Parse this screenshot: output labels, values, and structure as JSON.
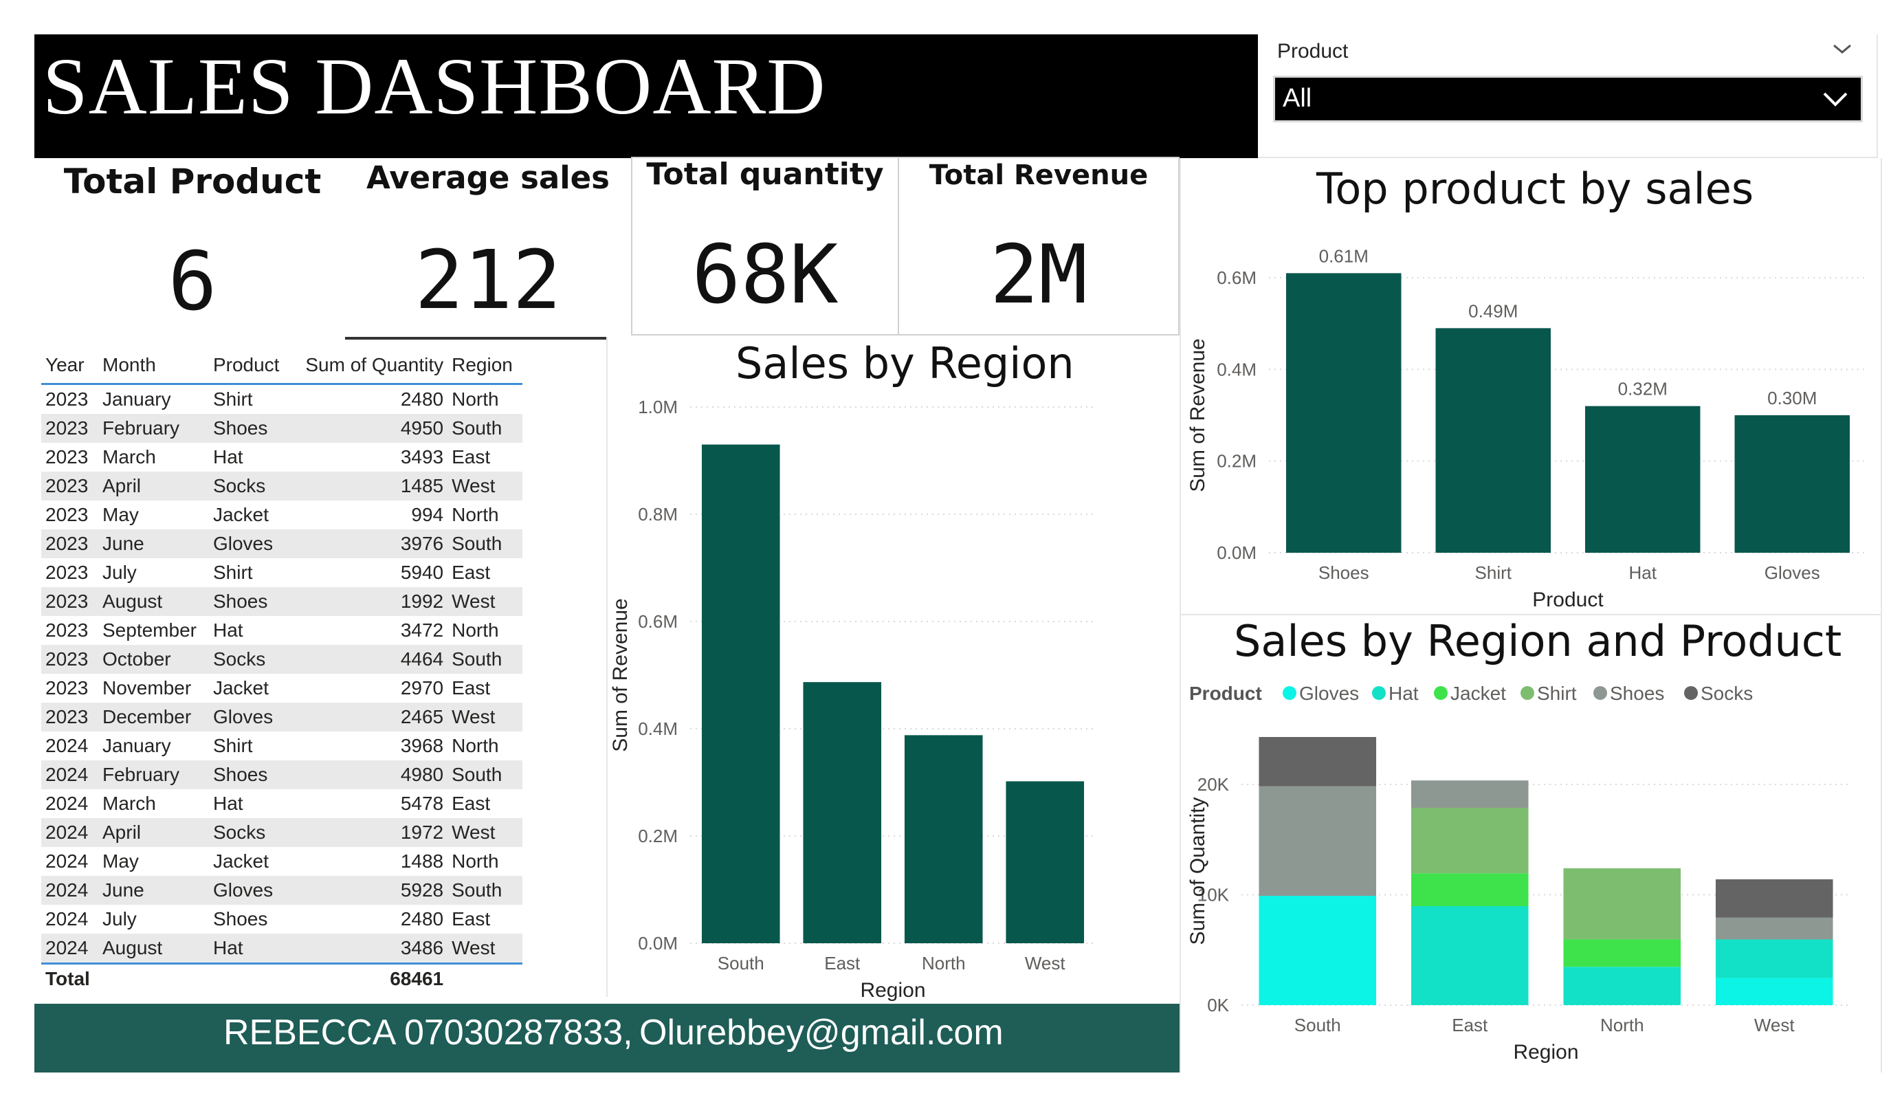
{
  "header": {
    "title": "SALES DASHBOARD"
  },
  "slicer": {
    "label": "Product",
    "value": "All"
  },
  "kpis": {
    "total_product": {
      "label": "Total Product",
      "value": "6"
    },
    "average_sales": {
      "label": "Average sales",
      "value": "212"
    },
    "total_quantity": {
      "label": "Total quantity",
      "value": "68K"
    },
    "total_revenue": {
      "label": "Total Revenue",
      "value": "2M"
    }
  },
  "table": {
    "columns": [
      "Year",
      "Month",
      "Product",
      "Sum of Quantity",
      "Region"
    ],
    "rows": [
      [
        "2023",
        "January",
        "Shirt",
        "2480",
        "North"
      ],
      [
        "2023",
        "February",
        "Shoes",
        "4950",
        "South"
      ],
      [
        "2023",
        "March",
        "Hat",
        "3493",
        "East"
      ],
      [
        "2023",
        "April",
        "Socks",
        "1485",
        "West"
      ],
      [
        "2023",
        "May",
        "Jacket",
        "994",
        "North"
      ],
      [
        "2023",
        "June",
        "Gloves",
        "3976",
        "South"
      ],
      [
        "2023",
        "July",
        "Shirt",
        "5940",
        "East"
      ],
      [
        "2023",
        "August",
        "Shoes",
        "1992",
        "West"
      ],
      [
        "2023",
        "September",
        "Hat",
        "3472",
        "North"
      ],
      [
        "2023",
        "October",
        "Socks",
        "4464",
        "South"
      ],
      [
        "2023",
        "November",
        "Jacket",
        "2970",
        "East"
      ],
      [
        "2023",
        "December",
        "Gloves",
        "2465",
        "West"
      ],
      [
        "2024",
        "January",
        "Shirt",
        "3968",
        "North"
      ],
      [
        "2024",
        "February",
        "Shoes",
        "4980",
        "South"
      ],
      [
        "2024",
        "March",
        "Hat",
        "5478",
        "East"
      ],
      [
        "2024",
        "April",
        "Socks",
        "1972",
        "West"
      ],
      [
        "2024",
        "May",
        "Jacket",
        "1488",
        "North"
      ],
      [
        "2024",
        "June",
        "Gloves",
        "5928",
        "South"
      ],
      [
        "2024",
        "July",
        "Shoes",
        "2480",
        "East"
      ],
      [
        "2024",
        "August",
        "Hat",
        "3486",
        "West"
      ]
    ],
    "total_label": "Total",
    "total_value": "68461"
  },
  "footer": {
    "name": "REBECCA  07030287833,",
    "email": "Olurebbey@gmail.com"
  },
  "colors": {
    "bar": "#08574c",
    "footer": "#1f5d57",
    "Gloves": "#0cf4e6",
    "Hat": "#13e1c7",
    "Jacket": "#3ee34b",
    "Shirt": "#7dbd70",
    "Shoes": "#8e9893",
    "Socks": "#646464"
  },
  "chart_data": [
    {
      "id": "region",
      "type": "bar",
      "title": "Sales by Region",
      "xlabel": "Region",
      "ylabel": "Sum of Revenue",
      "categories": [
        "South",
        "East",
        "North",
        "West"
      ],
      "values": [
        930000,
        487000,
        388000,
        302000
      ],
      "ylim": [
        0,
        1000000
      ],
      "ticks": [
        {
          "v": 0,
          "label": "0.0M"
        },
        {
          "v": 200000,
          "label": "0.2M"
        },
        {
          "v": 400000,
          "label": "0.4M"
        },
        {
          "v": 600000,
          "label": "0.6M"
        },
        {
          "v": 800000,
          "label": "0.8M"
        },
        {
          "v": 1000000,
          "label": "1.0M"
        }
      ],
      "grid": true
    },
    {
      "id": "product",
      "type": "bar",
      "title": "Top product by sales",
      "xlabel": "Product",
      "ylabel": "Sum of Revenue",
      "categories": [
        "Shoes",
        "Shirt",
        "Hat",
        "Gloves"
      ],
      "values": [
        610000,
        490000,
        320000,
        300000
      ],
      "data_labels": [
        "0.61M",
        "0.49M",
        "0.32M",
        "0.30M"
      ],
      "ylim": [
        0,
        600000
      ],
      "ticks": [
        {
          "v": 0,
          "label": "0.0M"
        },
        {
          "v": 200000,
          "label": "0.2M"
        },
        {
          "v": 400000,
          "label": "0.4M"
        },
        {
          "v": 600000,
          "label": "0.6M"
        }
      ],
      "grid": true
    },
    {
      "id": "stacked",
      "type": "bar",
      "stacked": true,
      "title": "Sales by Region and Product",
      "legend_title": "Product",
      "legend_position": "top-left",
      "xlabel": "Region",
      "ylabel": "Sum of Quantity",
      "categories": [
        "South",
        "East",
        "North",
        "West"
      ],
      "series": [
        {
          "name": "Gloves",
          "values": [
            9904,
            0,
            0,
            2465
          ]
        },
        {
          "name": "Hat",
          "values": [
            0,
            8971,
            3472,
            3486
          ]
        },
        {
          "name": "Jacket",
          "values": [
            0,
            2970,
            2482,
            0
          ]
        },
        {
          "name": "Shirt",
          "values": [
            0,
            5940,
            6448,
            0
          ]
        },
        {
          "name": "Shoes",
          "values": [
            9930,
            2480,
            0,
            1992
          ]
        },
        {
          "name": "Socks",
          "values": [
            4464,
            0,
            0,
            3457
          ]
        }
      ],
      "ylim": [
        0,
        24298
      ],
      "ticks": [
        {
          "v": 0,
          "label": "0K"
        },
        {
          "v": 10000,
          "label": "10K"
        },
        {
          "v": 20000,
          "label": "20K"
        }
      ],
      "grid": true
    }
  ]
}
